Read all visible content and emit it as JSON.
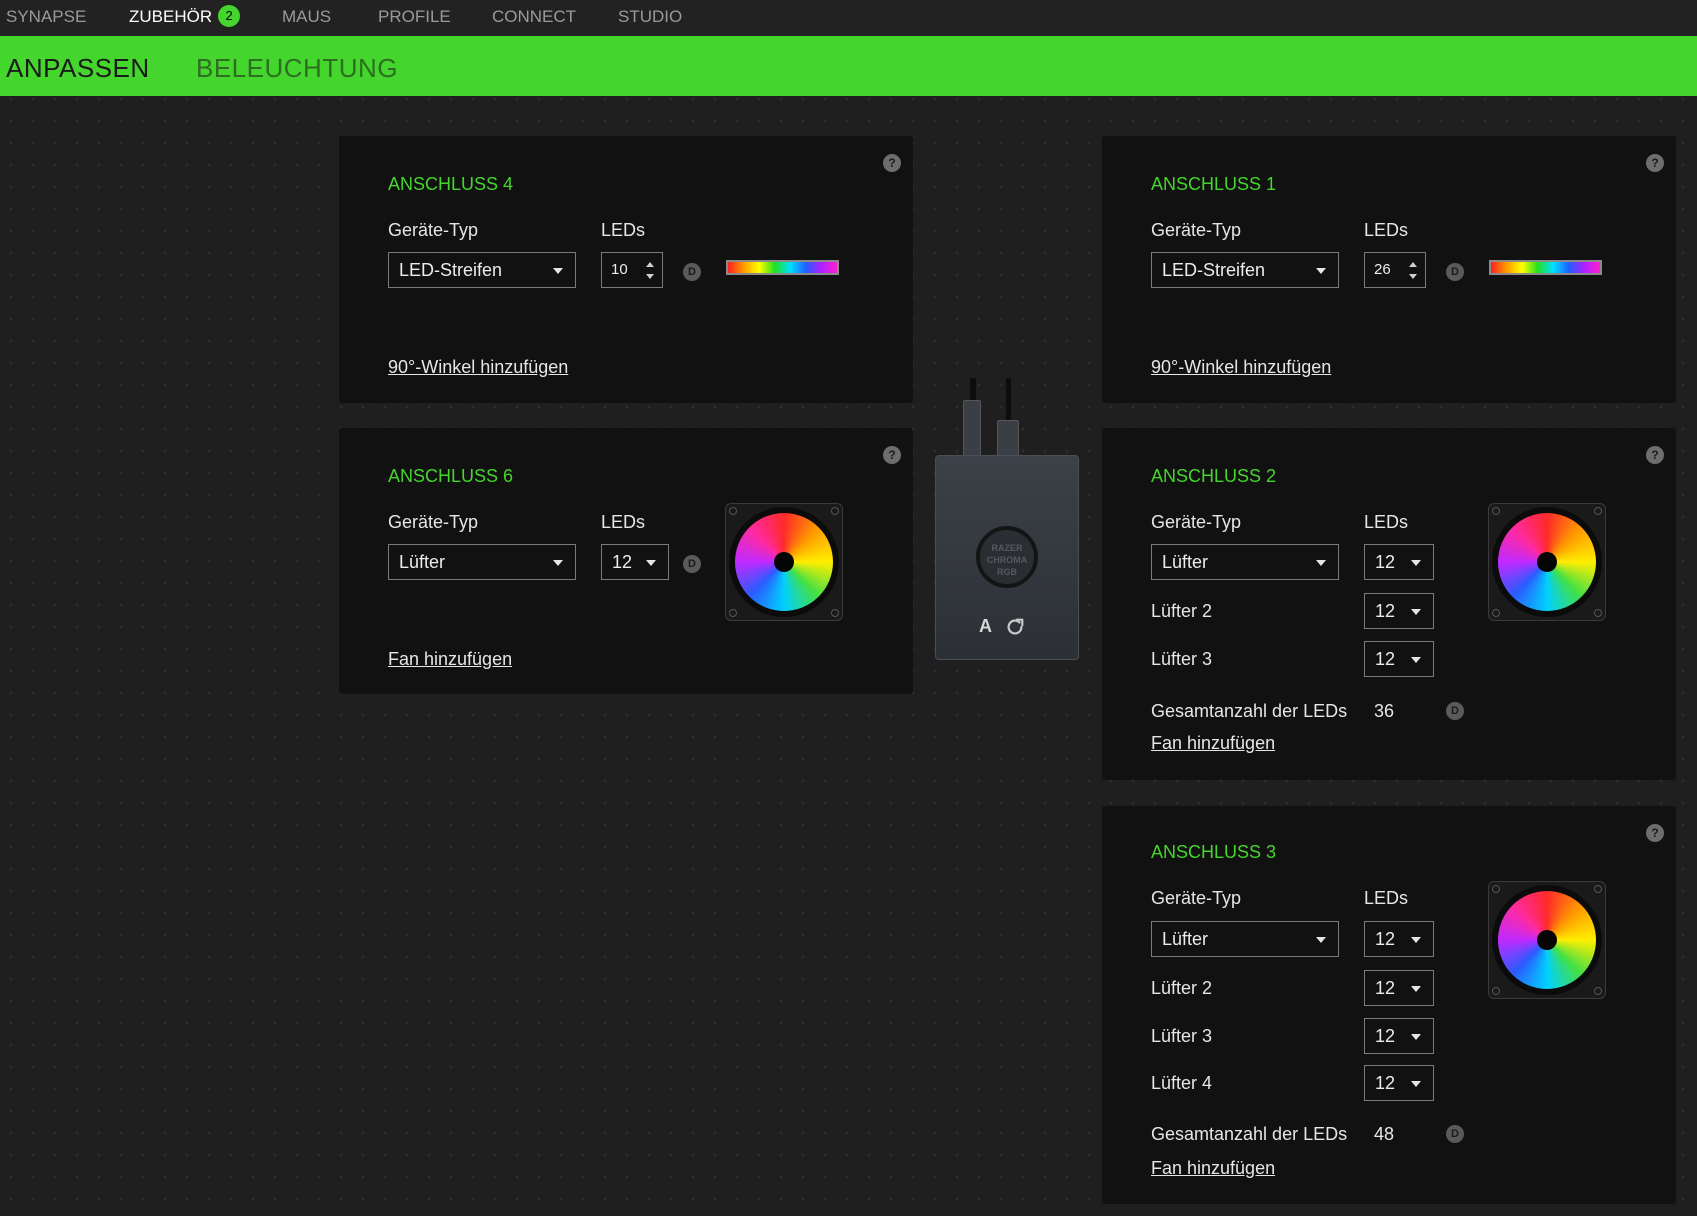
{
  "nav": {
    "tabs": [
      {
        "label": "SYNAPSE"
      },
      {
        "label": "ZUBEHÖR",
        "badge": "2"
      },
      {
        "label": "MAUS"
      },
      {
        "label": "PROFILE"
      },
      {
        "label": "CONNECT"
      },
      {
        "label": "STUDIO"
      }
    ],
    "active_tab": "ZUBEHÖR"
  },
  "subnav": {
    "items": [
      {
        "label": "ANPASSEN"
      },
      {
        "label": "BELEUCHTUNG"
      }
    ],
    "active": "ANPASSEN"
  },
  "colors": {
    "accent": "#44d62c",
    "panel_bg": "#111111",
    "page_bg": "#1f1f1f"
  },
  "labels": {
    "device_type": "Geräte-Typ",
    "leds": "LEDs",
    "d_badge": "D",
    "help": "?",
    "total_leds": "Gesamtanzahl der LEDs",
    "add_angle": "90°-Winkel hinzufügen",
    "add_fan": "Fan hinzufügen"
  },
  "ports": {
    "p4": {
      "title": "ANSCHLUSS 4",
      "device_type": "LED-Streifen",
      "leds": "10"
    },
    "p1": {
      "title": "ANSCHLUSS 1",
      "device_type": "LED-Streifen",
      "leds": "26"
    },
    "p6": {
      "title": "ANSCHLUSS 6",
      "device_type": "Lüfter",
      "leds": "12"
    },
    "p2": {
      "title": "ANSCHLUSS 2",
      "device_type": "Lüfter",
      "leds": "12",
      "fans": [
        {
          "label": "Lüfter  2",
          "leds": "12"
        },
        {
          "label": "Lüfter  3",
          "leds": "12"
        }
      ],
      "total": "36"
    },
    "p3": {
      "title": "ANSCHLUSS 3",
      "device_type": "Lüfter",
      "leds": "12",
      "fans": [
        {
          "label": "Lüfter  2",
          "leds": "12"
        },
        {
          "label": "Lüfter  3",
          "leds": "12"
        },
        {
          "label": "Lüfter  4",
          "leds": "12"
        }
      ],
      "total": "48"
    }
  },
  "hub": {
    "logo_text": "RAZER CHROMA RGB",
    "profile_letter": "A"
  },
  "icons": [
    "help-icon",
    "caret-down-icon",
    "spin-up-icon",
    "spin-down-icon",
    "default-d-icon",
    "refresh-icon",
    "fan-icon",
    "led-strip-icon"
  ]
}
